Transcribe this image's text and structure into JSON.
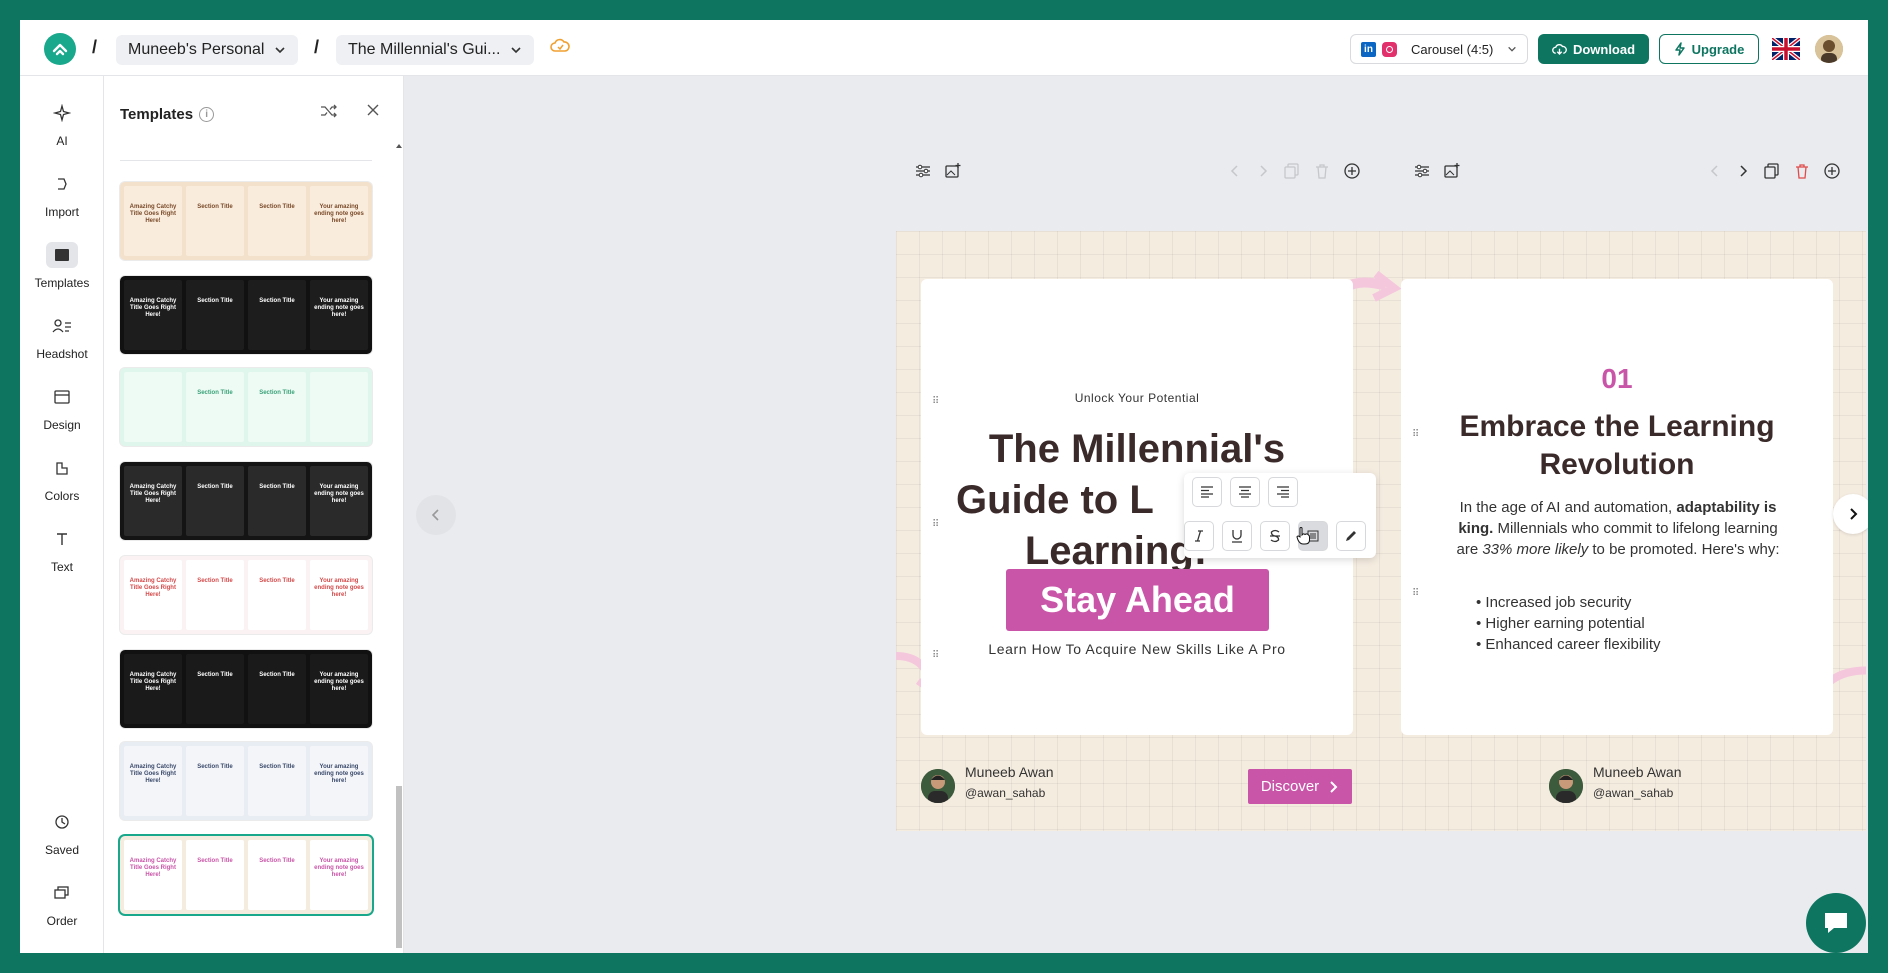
{
  "topbar": {
    "workspace": "Muneeb's Personal",
    "document": "The Millennial's Gui...",
    "format": "Carousel (4:5)",
    "download": "Download",
    "upgrade": "Upgrade"
  },
  "rail": {
    "items": [
      {
        "label": "AI",
        "icon": "sparkle-icon"
      },
      {
        "label": "Import",
        "icon": "import-icon"
      },
      {
        "label": "Templates",
        "icon": "templates-icon"
      },
      {
        "label": "Headshot",
        "icon": "headshot-icon"
      },
      {
        "label": "Design",
        "icon": "design-icon"
      },
      {
        "label": "Colors",
        "icon": "colors-icon"
      },
      {
        "label": "Text",
        "icon": "text-icon"
      },
      {
        "label": "Saved",
        "icon": "history-icon"
      },
      {
        "label": "Order",
        "icon": "order-icon"
      }
    ]
  },
  "panel": {
    "title": "Templates",
    "info": "i",
    "templates": [
      {
        "bg": "#f3e1cc",
        "page": "#f9ecdc",
        "text": "#7a4a2a",
        "sample": [
          "Amazing Catchy Title Goes Right Here!",
          "Section Title",
          "Section Title",
          "Your amazing ending note goes here!"
        ]
      },
      {
        "bg": "#111111",
        "page": "#1d1d1d",
        "text": "#ffffff",
        "sample": [
          "Amazing Catchy Title Goes Right Here!",
          "Section Title",
          "Section Title",
          "Your amazing ending note goes here!"
        ]
      },
      {
        "bg": "#dff6ec",
        "page": "#eefaf4",
        "text": "#3aa37a",
        "sample": [
          "",
          "Section Title",
          "Section Title",
          ""
        ]
      },
      {
        "bg": "#141414",
        "page": "#2a2a2a",
        "text": "#ffffff",
        "sample": [
          "Amazing Catchy Title Goes Right Here!",
          "Section Title",
          "Section Title",
          "Your amazing ending note goes here!"
        ]
      },
      {
        "bg": "#fbf3f3",
        "page": "#ffffff",
        "text": "#d44a4a",
        "sample": [
          "Amazing Catchy Title Goes Right Here!",
          "Section Title",
          "Section Title",
          "Your amazing ending note goes here!"
        ]
      },
      {
        "bg": "#111111",
        "page": "#1a1a1a",
        "text": "#ffffff",
        "sample": [
          "Amazing Catchy Title Goes Right Here!",
          "Section Title",
          "Section Title",
          "Your amazing ending note goes here!"
        ]
      },
      {
        "bg": "#e8ecf3",
        "page": "#f3f5f9",
        "text": "#3b4a6b",
        "sample": [
          "Amazing Catchy Title Goes Right Here!",
          "Section Title",
          "Section Title",
          "Your amazing ending note goes here!"
        ]
      },
      {
        "bg": "#f5ece0",
        "page": "#ffffff",
        "text": "#c955a8",
        "sample": [
          "Amazing Catchy Title Goes Right Here!",
          "Section Title",
          "Section Title",
          "Your amazing ending note goes here!"
        ]
      }
    ]
  },
  "slide1": {
    "eyebrow": "Unlock Your Potential",
    "title": "The Millennial's Guide to L      Learning:",
    "title_line1": "The Millennial's",
    "title_line2": "Guide to L",
    "title_line3": "Learning:",
    "highlight": "Stay Ahead",
    "subtitle": "Learn How To Acquire New Skills Like A Pro",
    "author_name": "Muneeb Awan",
    "author_handle": "@awan_sahab",
    "cta": "Discover"
  },
  "slide2": {
    "number": "01",
    "title_line1": "Embrace the Learning",
    "title_line2": "Revolution",
    "body_a": "In the age of AI and automation, ",
    "body_b": "adaptability is king.",
    "body_c": " Millennials who commit to lifelong learning are ",
    "body_d": "33% more likely",
    "body_e": " to be promoted. Here's why:",
    "bullets": [
      "Increased job security",
      "Higher earning potential",
      "Enhanced career flexibility"
    ],
    "author_name": "Muneeb Awan",
    "author_handle": "@awan_sahab"
  },
  "colors": {
    "brand": "#0d7560",
    "accent": "#c955a8",
    "canvas": "#f5ece0"
  }
}
